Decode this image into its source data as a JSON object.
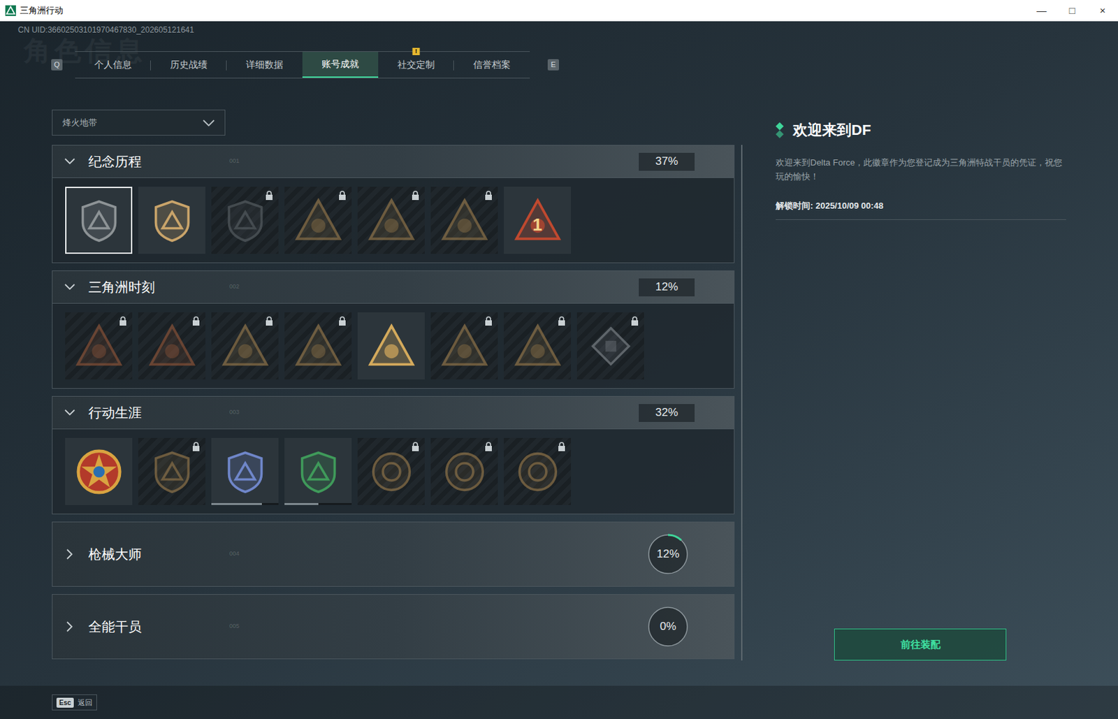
{
  "window": {
    "title": "三角洲行动",
    "controls": [
      "—",
      "□",
      "×"
    ]
  },
  "uid": "CN UID:36602503101970467830_202605121641",
  "page_title": "角色信息",
  "tabs": {
    "prev_key": "Q",
    "next_key": "E",
    "items": [
      {
        "label": "个人信息",
        "selected": false,
        "alert": false
      },
      {
        "label": "历史战绩",
        "selected": false,
        "alert": false
      },
      {
        "label": "详细数据",
        "selected": false,
        "alert": false
      },
      {
        "label": "账号成就",
        "selected": true,
        "alert": false
      },
      {
        "label": "社交定制",
        "selected": false,
        "alert": true
      },
      {
        "label": "信誉档案",
        "selected": false,
        "alert": false
      }
    ],
    "alert_text": "!"
  },
  "mode_select": {
    "value": "烽火地带"
  },
  "sections": [
    {
      "title": "纪念历程",
      "index": "001",
      "percent": "37%",
      "expanded": true,
      "level": 0.37,
      "badges": [
        {
          "kind": "shield",
          "color": "#8d9396",
          "locked": false,
          "selected": true
        },
        {
          "kind": "shield",
          "color": "#c9a46a",
          "locked": false,
          "selected": false
        },
        {
          "kind": "shield",
          "color": "#5f666a",
          "locked": true,
          "selected": false
        },
        {
          "kind": "triangle",
          "color": "#a3824f",
          "locked": true,
          "selected": false
        },
        {
          "kind": "triangle",
          "color": "#a3824f",
          "locked": true,
          "selected": false
        },
        {
          "kind": "triangle",
          "color": "#a3824f",
          "locked": true,
          "selected": false
        },
        {
          "kind": "triangle",
          "color": "#c0492f",
          "locked": false,
          "selected": false,
          "text": "1"
        }
      ]
    },
    {
      "title": "三角洲时刻",
      "index": "002",
      "percent": "12%",
      "expanded": true,
      "level": 0.12,
      "badges": [
        {
          "kind": "triangle",
          "color": "#9a5a3a",
          "locked": true,
          "selected": false
        },
        {
          "kind": "triangle",
          "color": "#9a5a3a",
          "locked": true,
          "selected": false
        },
        {
          "kind": "triangle",
          "color": "#a3824f",
          "locked": true,
          "selected": false
        },
        {
          "kind": "triangle",
          "color": "#a3824f",
          "locked": true,
          "selected": false
        },
        {
          "kind": "triangle",
          "color": "#d4aa5c",
          "locked": false,
          "selected": false
        },
        {
          "kind": "triangle",
          "color": "#a3824f",
          "locked": true,
          "selected": false
        },
        {
          "kind": "triangle",
          "color": "#a3824f",
          "locked": true,
          "selected": false
        },
        {
          "kind": "diamond",
          "color": "#8a9096",
          "locked": true,
          "selected": false
        }
      ]
    },
    {
      "title": "行动生涯",
      "index": "003",
      "percent": "32%",
      "expanded": true,
      "level": 0.32,
      "badges": [
        {
          "kind": "medal",
          "color": "#d9a441",
          "locked": false,
          "selected": false
        },
        {
          "kind": "shield",
          "color": "#a3824f",
          "locked": true,
          "selected": false
        },
        {
          "kind": "shield",
          "color": "#6f86c9",
          "locked": false,
          "selected": false,
          "level": 0.75
        },
        {
          "kind": "shield",
          "color": "#3f9a5a",
          "locked": false,
          "selected": false,
          "level": 0.5
        },
        {
          "kind": "round",
          "color": "#a3824f",
          "locked": true,
          "selected": false
        },
        {
          "kind": "round",
          "color": "#a3824f",
          "locked": true,
          "selected": false
        },
        {
          "kind": "round",
          "color": "#a3824f",
          "locked": true,
          "selected": false
        }
      ]
    },
    {
      "title": "枪械大师",
      "index": "004",
      "percent": "12%",
      "expanded": false,
      "level": 0.12,
      "badges": []
    },
    {
      "title": "全能干员",
      "index": "005",
      "percent": "0%",
      "expanded": false,
      "level": 0,
      "badges": []
    }
  ],
  "detail": {
    "title": "欢迎来到DF",
    "description": "欢迎来到Delta Force，此徽章作为您登记成为三角洲特战干员的凭证，祝您玩的愉快！",
    "unlock": "解锁时间: 2025/10/09 00:48",
    "button": "前往装配"
  },
  "footer": {
    "key": "Esc",
    "label": "返回"
  }
}
